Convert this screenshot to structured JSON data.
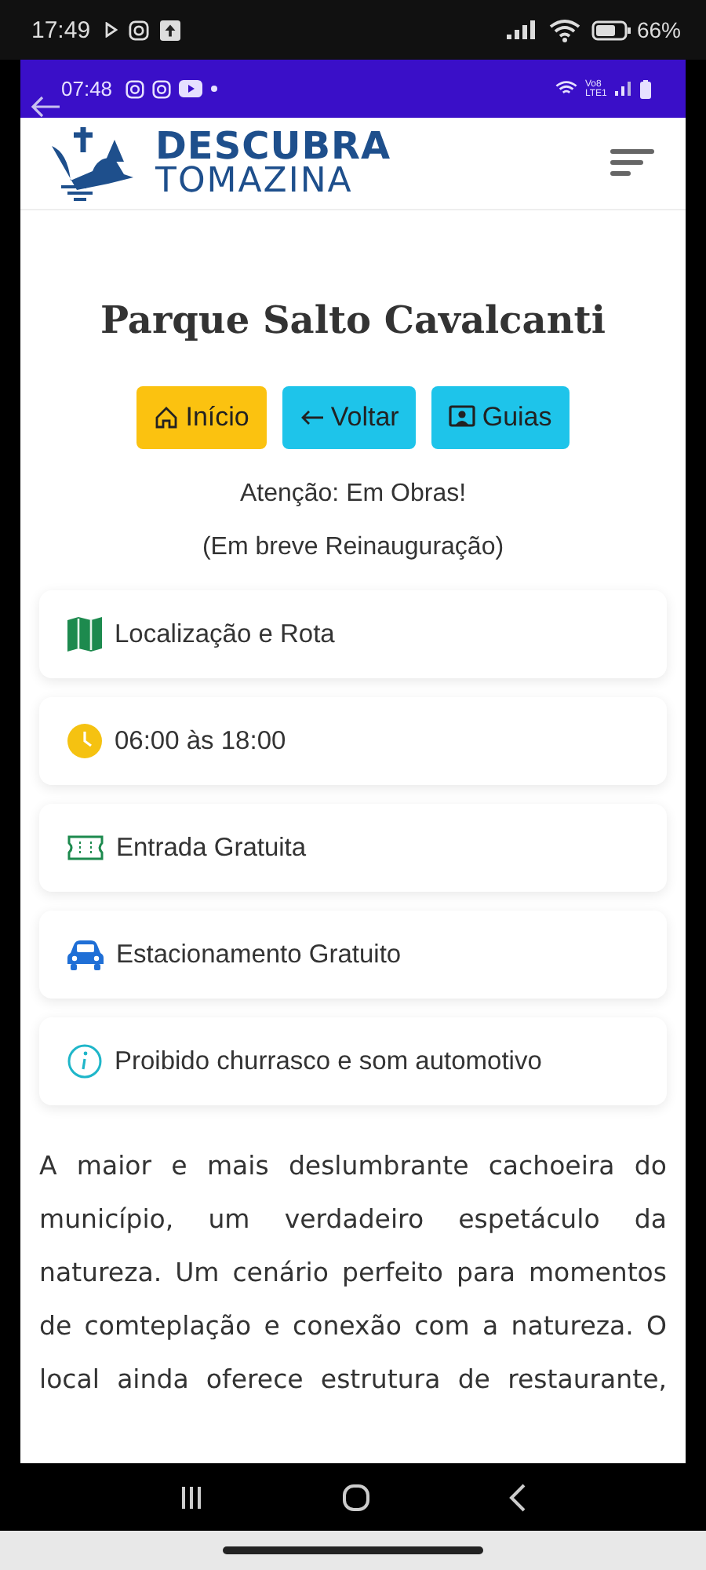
{
  "phone_status_bar": {
    "time": "17:49",
    "icons": [
      {
        "kind": "play"
      },
      {
        "kind": "instagram"
      },
      {
        "kind": "upload"
      }
    ],
    "battery": "66%"
  },
  "app_status_bar": {
    "time": "07:48",
    "icons": [
      {
        "kind": "instagram"
      },
      {
        "kind": "instagram"
      },
      {
        "kind": "youtube"
      },
      {
        "kind": "dot"
      }
    ],
    "network_label": "Vo8 LTE1"
  },
  "header": {
    "logo_top": "DESCUBRA",
    "logo_bottom": "TOMAZINA"
  },
  "title": "Parque Salto Cavalcanti",
  "buttons": [
    {
      "label": "Início",
      "kind": "home"
    },
    {
      "label": "Voltar",
      "kind": "back"
    },
    {
      "label": "Guias",
      "kind": "guides"
    }
  ],
  "notices": [
    "Atenção: Em Obras!",
    "(Em breve Reinauguração)"
  ],
  "info_cards": [
    {
      "kind": "map",
      "text": "Localização e Rota"
    },
    {
      "kind": "clock",
      "text": "06:00 às 18:00"
    },
    {
      "kind": "ticket",
      "text": "Entrada Gratuita"
    },
    {
      "kind": "car",
      "text": "Estacionamento Gratuito"
    },
    {
      "kind": "info",
      "text": "Proibido churrasco e som automotivo"
    }
  ],
  "description": "A maior e mais deslumbrante cachoeira do município, um verdadeiro espetáculo da natureza. Um cenário perfeito para momentos de comteplação e conexão com a natureza. O local ainda oferece estrutura de restaurante,"
}
